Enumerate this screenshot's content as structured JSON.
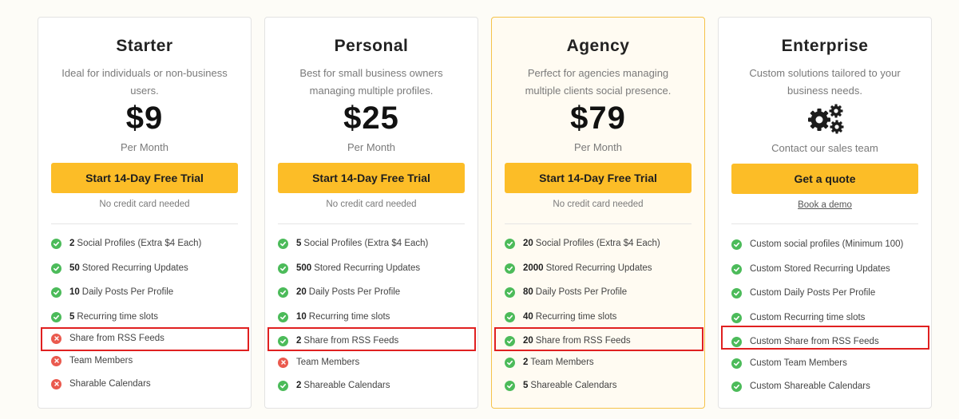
{
  "colors": {
    "accent": "#fcbd27",
    "check": "#4cbb5a",
    "cross": "#ea5a4e",
    "highlight_box": "#e02020"
  },
  "plans": [
    {
      "name": "Starter",
      "description": "Ideal for individuals or non-business users.",
      "price": "$9",
      "period": "Per Month",
      "cta": "Start 14-Day Free Trial",
      "note": "No credit card needed",
      "features": [
        {
          "num": "2",
          "text": "Social Profiles (Extra $4 Each)",
          "icon": "check-icon"
        },
        {
          "num": "50",
          "text": "Stored Recurring Updates",
          "icon": "check-icon"
        },
        {
          "num": "10",
          "text": "Daily Posts Per Profile",
          "icon": "check-icon"
        },
        {
          "num": "5",
          "text": "Recurring time slots",
          "icon": "check-icon"
        },
        {
          "num": "",
          "text": "Share from RSS Feeds",
          "icon": "cross-icon"
        },
        {
          "num": "",
          "text": "Team Members",
          "icon": "cross-icon"
        },
        {
          "num": "",
          "text": "Sharable Calendars",
          "icon": "cross-icon"
        }
      ]
    },
    {
      "name": "Personal",
      "description": "Best for small business owners managing multiple profiles.",
      "price": "$25",
      "period": "Per Month",
      "cta": "Start 14-Day Free Trial",
      "note": "No credit card needed",
      "features": [
        {
          "num": "5",
          "text": "Social Profiles (Extra $4 Each)",
          "icon": "check-icon"
        },
        {
          "num": "500",
          "text": "Stored Recurring Updates",
          "icon": "check-icon"
        },
        {
          "num": "20",
          "text": "Daily Posts Per Profile",
          "icon": "check-icon"
        },
        {
          "num": "10",
          "text": "Recurring time slots",
          "icon": "check-icon"
        },
        {
          "num": "2",
          "text": "Share from RSS Feeds",
          "icon": "check-icon"
        },
        {
          "num": "",
          "text": "Team Members",
          "icon": "cross-icon"
        },
        {
          "num": "2",
          "text": "Shareable Calendars",
          "icon": "check-icon"
        }
      ]
    },
    {
      "name": "Agency",
      "description": "Perfect for agencies managing multiple clients social presence.",
      "price": "$79",
      "period": "Per Month",
      "cta": "Start 14-Day Free Trial",
      "note": "No credit card needed",
      "features": [
        {
          "num": "20",
          "text": "Social Profiles (Extra $4 Each)",
          "icon": "check-icon"
        },
        {
          "num": "2000",
          "text": "Stored Recurring Updates",
          "icon": "check-icon"
        },
        {
          "num": "80",
          "text": "Daily Posts Per Profile",
          "icon": "check-icon"
        },
        {
          "num": "40",
          "text": "Recurring time slots",
          "icon": "check-icon"
        },
        {
          "num": "20",
          "text": "Share from RSS Feeds",
          "icon": "check-icon"
        },
        {
          "num": "2",
          "text": "Team Members",
          "icon": "check-icon"
        },
        {
          "num": "5",
          "text": "Shareable Calendars",
          "icon": "check-icon"
        }
      ]
    },
    {
      "name": "Enterprise",
      "description": "Custom solutions tailored to your business needs.",
      "icon": "gears-icon",
      "contact": "Contact our sales team",
      "cta": "Get a quote",
      "link": "Book a demo",
      "features": [
        {
          "num": "",
          "text": "Custom social profiles (Minimum 100)",
          "icon": "check-icon"
        },
        {
          "num": "",
          "text": "Custom Stored Recurring Updates",
          "icon": "check-icon"
        },
        {
          "num": "",
          "text": "Custom Daily Posts Per Profile",
          "icon": "check-icon"
        },
        {
          "num": "",
          "text": "Custom Recurring time slots",
          "icon": "check-icon"
        },
        {
          "num": "",
          "text": "Custom Share from RSS Feeds",
          "icon": "check-icon"
        },
        {
          "num": "",
          "text": "Custom Team Members",
          "icon": "check-icon"
        },
        {
          "num": "",
          "text": "Custom Shareable Calendars",
          "icon": "check-icon"
        }
      ]
    }
  ]
}
